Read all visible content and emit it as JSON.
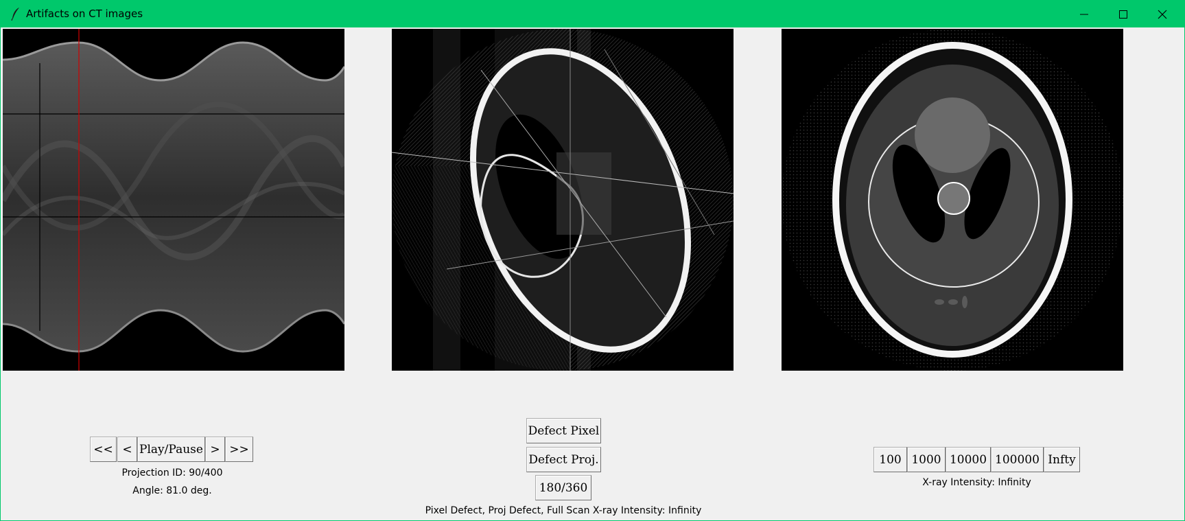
{
  "window": {
    "title": "Artifacts on CT images",
    "accent_color": "#00c86b",
    "controls": [
      "minimize-icon",
      "maximize-icon",
      "close-icon"
    ]
  },
  "sinogram_panel": {
    "projection_marker_color": "#d00000",
    "buttons": {
      "first": "<<",
      "prev": "<",
      "play_pause": "Play/Pause",
      "next": ">",
      "last": ">>"
    },
    "projection_id": "Projection ID: 90/400",
    "angle": "Angle: 81.0 deg."
  },
  "reconstruction_panel": {
    "buttons": {
      "defect_pixel": "Defect Pixel",
      "defect_proj": "Defect Proj.",
      "scan_range": "180/360"
    },
    "status": "Pixel Defect, Proj Defect, Full Scan X-ray Intensity: Infinity"
  },
  "intensity_panel": {
    "buttons": [
      "100",
      "1000",
      "10000",
      "100000",
      "Infty"
    ],
    "status": "X-ray Intensity: Infinity"
  }
}
